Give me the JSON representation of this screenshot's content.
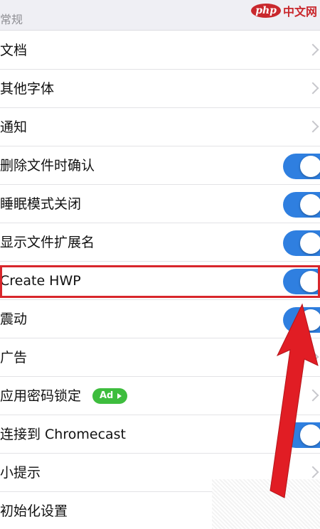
{
  "section": {
    "title": "常规"
  },
  "watermark": {
    "logo": "php",
    "site": "中文网"
  },
  "rows": [
    {
      "label": "文档",
      "control": "chevron"
    },
    {
      "label": "其他字体",
      "control": "chevron"
    },
    {
      "label": "通知",
      "control": "chevron"
    },
    {
      "label": "删除文件时确认",
      "control": "toggle",
      "on": true
    },
    {
      "label": "睡眠模式关闭",
      "control": "toggle",
      "on": true
    },
    {
      "label": "显示文件扩展名",
      "control": "toggle",
      "on": true
    },
    {
      "label": "Create HWP",
      "control": "toggle",
      "on": true
    },
    {
      "label": "震动",
      "control": "toggle",
      "on": true
    },
    {
      "label": "广告",
      "control": "chevron"
    },
    {
      "label": "应用密码锁定",
      "control": "chevron",
      "badge": "Ad"
    },
    {
      "label": "连接到 Chromecast",
      "control": "toggle",
      "on": true
    },
    {
      "label": "小提示",
      "control": "chevron"
    },
    {
      "label": "初始化设置",
      "control": "none"
    }
  ],
  "colors": {
    "toggle_on": "#2f7fe0",
    "highlight": "#d8262b",
    "ad_badge": "#3ebd3e"
  }
}
